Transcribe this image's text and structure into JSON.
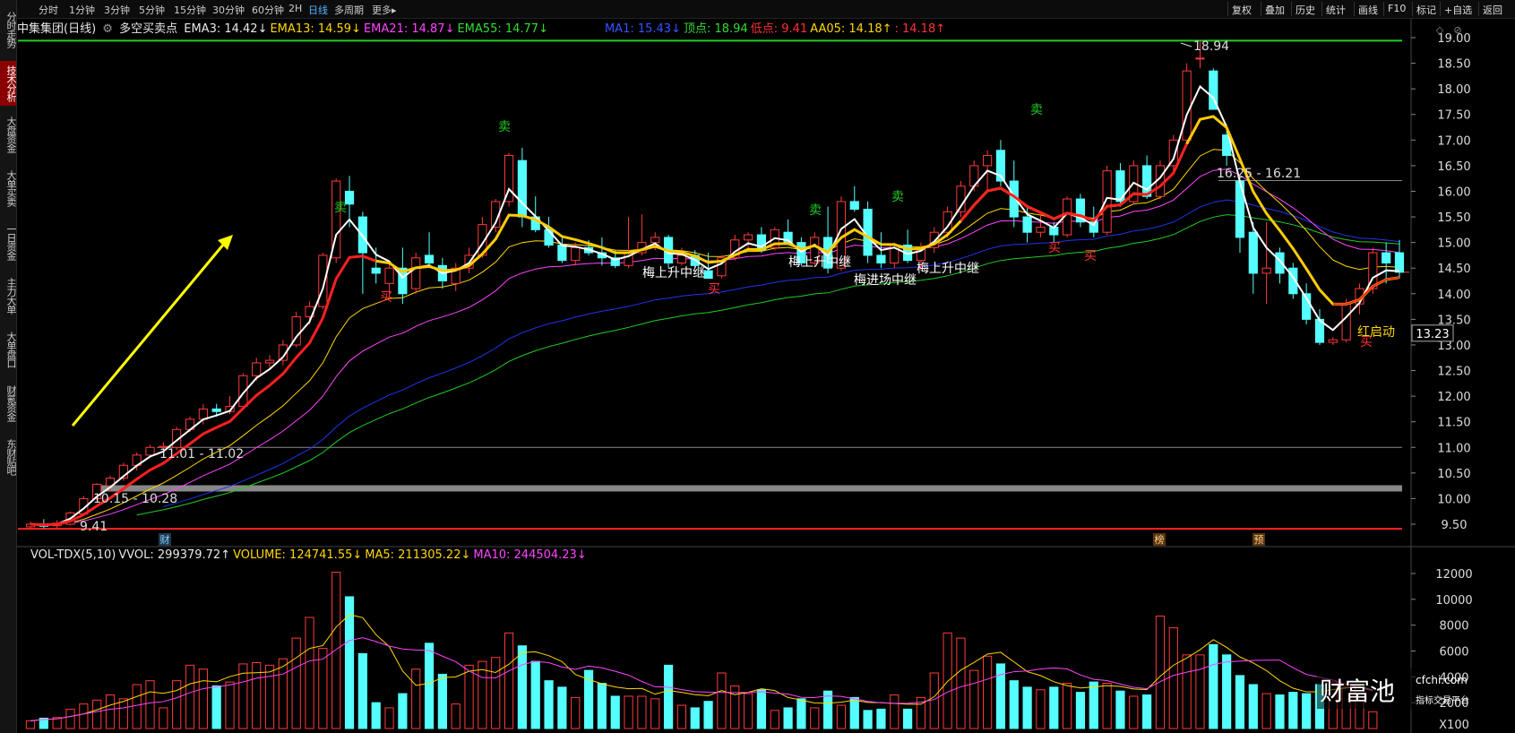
{
  "sidebar": {
    "tabs": [
      {
        "label": "分时走势",
        "active": false
      },
      {
        "label": "技术分析",
        "active": true
      },
      {
        "label": "大盘资金",
        "active": false
      },
      {
        "label": "大单买卖",
        "active": false
      },
      {
        "label": "一日资金",
        "active": false
      },
      {
        "label": "主力大单",
        "active": false
      },
      {
        "label": "大单盘口",
        "active": false
      },
      {
        "label": "财氪资金",
        "active": false
      },
      {
        "label": "东财贴吧",
        "active": false
      }
    ]
  },
  "toolbar": {
    "periods": [
      "分时",
      "1分钟",
      "3分钟",
      "5分钟",
      "15分钟",
      "30分钟",
      "60分钟",
      "2H",
      "日线",
      "多周期",
      "更多▸"
    ],
    "active_period": "日线",
    "right_buttons": [
      "复权",
      "叠加",
      "历史",
      "统计",
      "画线",
      "F10",
      "标记",
      "+自选",
      "返回"
    ]
  },
  "indicator": {
    "stock_name": "中集集团(日线)",
    "indicator_name": "多空买卖点",
    "items": [
      {
        "text": "EMA3: 14.42↓",
        "color": "#e8e8e8"
      },
      {
        "text": "EMA13: 14.59↓",
        "color": "#ffd700"
      },
      {
        "text": "EMA21: 14.87↓",
        "color": "#ff44ff"
      },
      {
        "text": "EMA55: 14.77↓",
        "color": "#33dd33"
      },
      {
        "text": "MA1: 15.43↓",
        "color": "#3355ff"
      },
      {
        "text": "顶点: 18.94",
        "color": "#33dd33"
      },
      {
        "text": "低点: 9.41",
        "color": "#ff3333"
      },
      {
        "text": "AA05: 14.18↑",
        "color": "#ffd700"
      },
      {
        "text": ": 14.18↑",
        "color": "#ff3333"
      }
    ]
  },
  "volume": {
    "items": [
      {
        "text": "VOL-TDX(5,10)",
        "color": "#e8e8e8"
      },
      {
        "text": "VVOL: 299379.72↑",
        "color": "#e8e8e8"
      },
      {
        "text": "VOLUME: 124741.55↓",
        "color": "#ffd700"
      },
      {
        "text": "MA5: 211305.22↓",
        "color": "#ffd700"
      },
      {
        "text": "MA10: 244504.23↓",
        "color": "#ff44ff"
      }
    ],
    "multiplier": "X100"
  },
  "annotations": {
    "top_price": "18.94",
    "low_price": "9.41",
    "range1": "10.15 - 10.28",
    "range2": "11.01 - 11.02",
    "range3": "16.25 - 16.21",
    "current_price": "13.23",
    "sell_label": "卖",
    "buy_label": "买",
    "relay_label": "梅上升中继",
    "relay_label2": "梅进场中继",
    "red_start": "红启动",
    "finance_label": "财",
    "rank_label": "榜",
    "pre_label": "预"
  },
  "logo": {
    "brand": "财富池",
    "site": "cfchi.com",
    "slogan": "指标交易平台"
  },
  "colors": {
    "up": "#ff3a3a",
    "down": "#55ffff",
    "grid": "#2a2a2a",
    "text": "#ddd"
  },
  "chart_data": {
    "type": "candlestick",
    "price_axis": {
      "ticks": [
        9.5,
        10.0,
        10.5,
        11.0,
        11.5,
        12.0,
        12.5,
        13.0,
        13.5,
        14.0,
        14.5,
        15.0,
        15.5,
        16.0,
        16.5,
        17.0,
        17.5,
        18.0,
        18.5,
        19.0
      ]
    },
    "volume_axis": {
      "ticks": [
        2000,
        4000,
        6000,
        8000,
        10000,
        12000
      ]
    },
    "candles": [
      {
        "o": 9.45,
        "h": 9.55,
        "l": 9.41,
        "c": 9.5
      },
      {
        "o": 9.48,
        "h": 9.6,
        "l": 9.42,
        "c": 9.46
      },
      {
        "o": 9.47,
        "h": 9.58,
        "l": 9.43,
        "c": 9.52
      },
      {
        "o": 9.5,
        "h": 9.75,
        "l": 9.48,
        "c": 9.72
      },
      {
        "o": 9.7,
        "h": 10.05,
        "l": 9.68,
        "c": 10.0
      },
      {
        "o": 10.0,
        "h": 10.3,
        "l": 9.95,
        "c": 10.28
      },
      {
        "o": 10.25,
        "h": 10.45,
        "l": 10.15,
        "c": 10.4
      },
      {
        "o": 10.4,
        "h": 10.7,
        "l": 10.35,
        "c": 10.65
      },
      {
        "o": 10.65,
        "h": 10.9,
        "l": 10.55,
        "c": 10.85
      },
      {
        "o": 10.85,
        "h": 11.05,
        "l": 10.8,
        "c": 11.0
      },
      {
        "o": 11.0,
        "h": 11.1,
        "l": 10.95,
        "c": 11.02
      },
      {
        "o": 11.0,
        "h": 11.4,
        "l": 10.95,
        "c": 11.35
      },
      {
        "o": 11.35,
        "h": 11.6,
        "l": 11.3,
        "c": 11.55
      },
      {
        "o": 11.55,
        "h": 11.85,
        "l": 11.45,
        "c": 11.75
      },
      {
        "o": 11.75,
        "h": 11.85,
        "l": 11.6,
        "c": 11.7
      },
      {
        "o": 11.7,
        "h": 12.0,
        "l": 11.65,
        "c": 11.8
      },
      {
        "o": 11.8,
        "h": 12.45,
        "l": 11.75,
        "c": 12.4
      },
      {
        "o": 12.4,
        "h": 12.75,
        "l": 12.3,
        "c": 12.65
      },
      {
        "o": 12.65,
        "h": 12.8,
        "l": 12.55,
        "c": 12.7
      },
      {
        "o": 12.7,
        "h": 13.1,
        "l": 12.6,
        "c": 13.0
      },
      {
        "o": 13.0,
        "h": 13.65,
        "l": 12.95,
        "c": 13.55
      },
      {
        "o": 13.55,
        "h": 13.85,
        "l": 13.4,
        "c": 13.75
      },
      {
        "o": 13.75,
        "h": 14.8,
        "l": 13.7,
        "c": 14.75
      },
      {
        "o": 14.7,
        "h": 16.25,
        "l": 14.6,
        "c": 16.2
      },
      {
        "o": 16.0,
        "h": 16.3,
        "l": 15.3,
        "c": 15.75
      },
      {
        "o": 15.5,
        "h": 15.6,
        "l": 14.0,
        "c": 14.8
      },
      {
        "o": 14.5,
        "h": 14.9,
        "l": 14.2,
        "c": 14.4
      },
      {
        "o": 14.2,
        "h": 14.6,
        "l": 13.9,
        "c": 14.5
      },
      {
        "o": 14.5,
        "h": 14.9,
        "l": 13.8,
        "c": 14.0
      },
      {
        "o": 14.1,
        "h": 14.8,
        "l": 14.0,
        "c": 14.7
      },
      {
        "o": 14.75,
        "h": 15.2,
        "l": 14.5,
        "c": 14.6
      },
      {
        "o": 14.55,
        "h": 14.7,
        "l": 14.1,
        "c": 14.25
      },
      {
        "o": 14.2,
        "h": 14.6,
        "l": 14.05,
        "c": 14.5
      },
      {
        "o": 14.5,
        "h": 14.9,
        "l": 14.4,
        "c": 14.75
      },
      {
        "o": 14.75,
        "h": 15.5,
        "l": 14.7,
        "c": 15.35
      },
      {
        "o": 15.3,
        "h": 15.85,
        "l": 15.2,
        "c": 15.8
      },
      {
        "o": 15.8,
        "h": 16.75,
        "l": 15.7,
        "c": 16.7
      },
      {
        "o": 16.6,
        "h": 16.85,
        "l": 15.3,
        "c": 15.5
      },
      {
        "o": 15.5,
        "h": 15.9,
        "l": 15.2,
        "c": 15.25
      },
      {
        "o": 15.25,
        "h": 15.5,
        "l": 14.9,
        "c": 14.95
      },
      {
        "o": 14.95,
        "h": 15.1,
        "l": 14.6,
        "c": 14.65
      },
      {
        "o": 14.65,
        "h": 15.0,
        "l": 14.55,
        "c": 14.9
      },
      {
        "o": 14.9,
        "h": 15.05,
        "l": 14.75,
        "c": 14.8
      },
      {
        "o": 14.8,
        "h": 15.1,
        "l": 14.55,
        "c": 14.7
      },
      {
        "o": 14.7,
        "h": 14.85,
        "l": 14.5,
        "c": 14.55
      },
      {
        "o": 14.55,
        "h": 15.5,
        "l": 14.5,
        "c": 14.8
      },
      {
        "o": 14.8,
        "h": 15.55,
        "l": 14.75,
        "c": 15.0
      },
      {
        "o": 15.0,
        "h": 15.2,
        "l": 14.85,
        "c": 15.1
      },
      {
        "o": 15.1,
        "h": 15.15,
        "l": 14.5,
        "c": 14.6
      },
      {
        "o": 14.6,
        "h": 14.9,
        "l": 14.55,
        "c": 14.75
      },
      {
        "o": 14.75,
        "h": 14.85,
        "l": 14.5,
        "c": 14.55
      },
      {
        "o": 14.45,
        "h": 14.8,
        "l": 14.35,
        "c": 14.3
      },
      {
        "o": 14.35,
        "h": 14.75,
        "l": 14.3,
        "c": 14.7
      },
      {
        "o": 14.7,
        "h": 15.15,
        "l": 14.65,
        "c": 15.05
      },
      {
        "o": 15.05,
        "h": 15.2,
        "l": 14.85,
        "c": 15.15
      },
      {
        "o": 15.15,
        "h": 15.3,
        "l": 14.8,
        "c": 14.85
      },
      {
        "o": 14.9,
        "h": 15.3,
        "l": 14.85,
        "c": 15.25
      },
      {
        "o": 15.2,
        "h": 15.45,
        "l": 14.95,
        "c": 15.0
      },
      {
        "o": 15.0,
        "h": 15.1,
        "l": 14.55,
        "c": 14.6
      },
      {
        "o": 14.6,
        "h": 15.2,
        "l": 14.55,
        "c": 15.1
      },
      {
        "o": 15.1,
        "h": 15.7,
        "l": 14.4,
        "c": 14.5
      },
      {
        "o": 14.5,
        "h": 15.9,
        "l": 14.45,
        "c": 15.8
      },
      {
        "o": 15.8,
        "h": 16.1,
        "l": 15.6,
        "c": 15.65
      },
      {
        "o": 15.65,
        "h": 15.8,
        "l": 14.6,
        "c": 14.75
      },
      {
        "o": 14.75,
        "h": 15.2,
        "l": 14.5,
        "c": 14.6
      },
      {
        "o": 14.6,
        "h": 15.0,
        "l": 14.5,
        "c": 14.95
      },
      {
        "o": 14.95,
        "h": 15.25,
        "l": 14.6,
        "c": 14.65
      },
      {
        "o": 14.65,
        "h": 15.0,
        "l": 14.45,
        "c": 14.9
      },
      {
        "o": 14.9,
        "h": 15.3,
        "l": 14.8,
        "c": 15.2
      },
      {
        "o": 15.2,
        "h": 15.7,
        "l": 15.1,
        "c": 15.6
      },
      {
        "o": 15.6,
        "h": 16.2,
        "l": 15.5,
        "c": 16.1
      },
      {
        "o": 16.1,
        "h": 16.6,
        "l": 16.0,
        "c": 16.5
      },
      {
        "o": 16.5,
        "h": 16.8,
        "l": 16.0,
        "c": 16.7
      },
      {
        "o": 16.8,
        "h": 17.0,
        "l": 16.1,
        "c": 16.2
      },
      {
        "o": 16.2,
        "h": 16.6,
        "l": 15.3,
        "c": 15.5
      },
      {
        "o": 15.5,
        "h": 15.7,
        "l": 15.0,
        "c": 15.2
      },
      {
        "o": 15.2,
        "h": 15.6,
        "l": 15.1,
        "c": 15.3
      },
      {
        "o": 15.3,
        "h": 15.4,
        "l": 15.0,
        "c": 15.15
      },
      {
        "o": 15.15,
        "h": 15.9,
        "l": 15.1,
        "c": 15.85
      },
      {
        "o": 15.85,
        "h": 15.95,
        "l": 15.3,
        "c": 15.4
      },
      {
        "o": 15.4,
        "h": 15.7,
        "l": 15.1,
        "c": 15.2
      },
      {
        "o": 15.2,
        "h": 16.5,
        "l": 15.15,
        "c": 16.4
      },
      {
        "o": 16.4,
        "h": 16.55,
        "l": 15.7,
        "c": 15.8
      },
      {
        "o": 15.8,
        "h": 16.6,
        "l": 15.75,
        "c": 16.5
      },
      {
        "o": 16.5,
        "h": 16.7,
        "l": 15.85,
        "c": 15.9
      },
      {
        "o": 15.9,
        "h": 16.6,
        "l": 15.85,
        "c": 16.5
      },
      {
        "o": 16.5,
        "h": 17.1,
        "l": 16.4,
        "c": 17.0
      },
      {
        "o": 17.0,
        "h": 18.5,
        "l": 16.9,
        "c": 18.35
      },
      {
        "o": 18.6,
        "h": 18.94,
        "l": 18.4,
        "c": 18.6
      },
      {
        "o": 18.35,
        "h": 18.4,
        "l": 17.6,
        "c": 17.6
      },
      {
        "o": 17.1,
        "h": 17.3,
        "l": 16.5,
        "c": 16.7
      },
      {
        "o": 16.2,
        "h": 16.3,
        "l": 14.8,
        "c": 15.1
      },
      {
        "o": 15.2,
        "h": 15.4,
        "l": 14.0,
        "c": 14.4
      },
      {
        "o": 14.4,
        "h": 15.4,
        "l": 13.8,
        "c": 14.5
      },
      {
        "o": 14.8,
        "h": 14.9,
        "l": 14.2,
        "c": 14.4
      },
      {
        "o": 14.5,
        "h": 14.6,
        "l": 13.9,
        "c": 14.0
      },
      {
        "o": 14.0,
        "h": 14.2,
        "l": 13.4,
        "c": 13.5
      },
      {
        "o": 13.5,
        "h": 13.7,
        "l": 13.0,
        "c": 13.05
      },
      {
        "o": 13.05,
        "h": 13.15,
        "l": 13.0,
        "c": 13.1
      },
      {
        "o": 13.1,
        "h": 13.9,
        "l": 13.05,
        "c": 13.8
      },
      {
        "o": 13.8,
        "h": 14.2,
        "l": 13.6,
        "c": 14.1
      },
      {
        "o": 14.1,
        "h": 14.9,
        "l": 14.0,
        "c": 14.8
      },
      {
        "o": 14.8,
        "h": 15.0,
        "l": 14.2,
        "c": 14.6
      },
      {
        "o": 14.8,
        "h": 15.05,
        "l": 14.3,
        "c": 14.42
      }
    ],
    "volumes": [
      600,
      800,
      850,
      1500,
      1900,
      2200,
      2600,
      2300,
      3400,
      3700,
      1600,
      3700,
      4900,
      4600,
      3300,
      3600,
      5000,
      5100,
      4900,
      5400,
      7000,
      8600,
      6200,
      12100,
      10200,
      5800,
      2000,
      1600,
      2700,
      4600,
      6600,
      4200,
      1900,
      4900,
      5200,
      5500,
      7400,
      6400,
      5200,
      3700,
      3200,
      2400,
      4500,
      3500,
      2500,
      2500,
      2500,
      2300,
      4900,
      1800,
      1600,
      2100,
      4300,
      3300,
      2700,
      3000,
      1400,
      1600,
      2300,
      1600,
      2900,
      1800,
      2400,
      1400,
      1500,
      2600,
      1500,
      2400,
      4300,
      7400,
      7000,
      4500,
      5600,
      5000,
      3700,
      3200,
      3000,
      3200,
      3500,
      2800,
      3600,
      3500,
      2900,
      2500,
      2600,
      8700,
      7800,
      5700,
      5700,
      6500,
      5700,
      4100,
      3400,
      2700,
      2600,
      2800,
      2700,
      3400,
      3600,
      3200,
      3400,
      1300
    ],
    "ma_lines": [
      "EMA3",
      "EMA13",
      "EMA21",
      "EMA55",
      "MA1",
      "AA05"
    ]
  }
}
